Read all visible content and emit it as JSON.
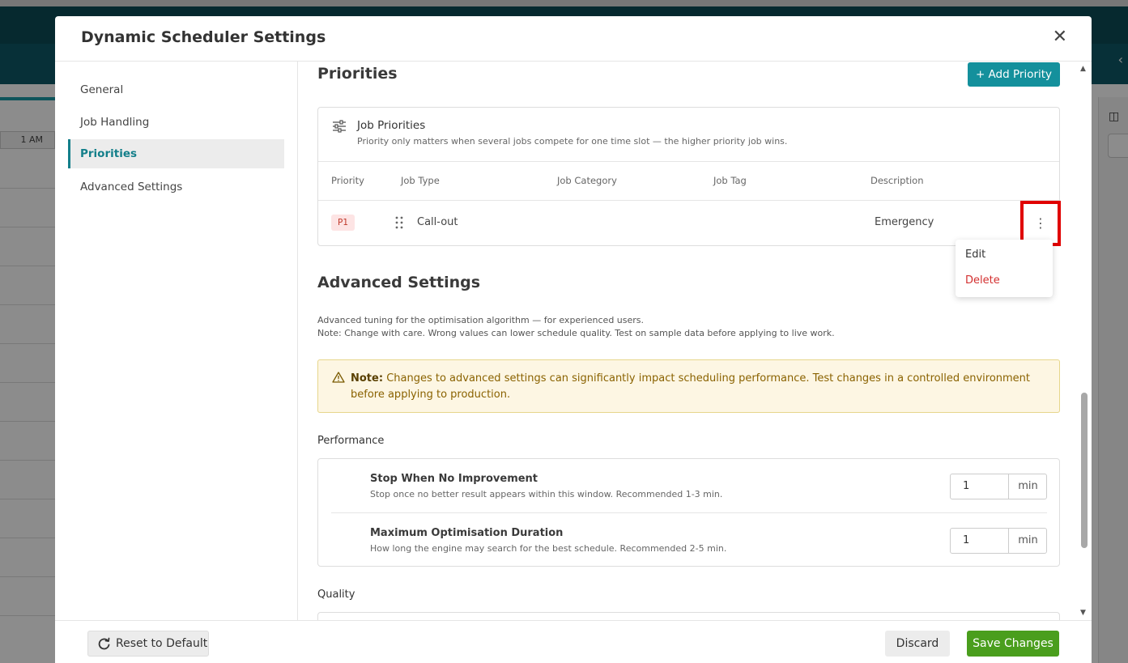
{
  "background": {
    "timeline_label": "1 AM",
    "colors": {
      "header": "#0b4b57",
      "accent": "#1b9aa6"
    }
  },
  "modal": {
    "title": "Dynamic Scheduler Settings",
    "close_icon": "close-icon"
  },
  "sidebar": {
    "items": [
      {
        "label": "General",
        "active": false
      },
      {
        "label": "Job Handling",
        "active": false
      },
      {
        "label": "Priorities",
        "active": true
      },
      {
        "label": "Advanced Settings",
        "active": false
      }
    ]
  },
  "priorities": {
    "title": "Priorities",
    "add_button": "+ Add Priority",
    "card_title": "Job Priorities",
    "card_subtitle": "Priority only matters when several jobs compete for one time slot — the higher priority job wins.",
    "columns": [
      "Priority",
      "Job Type",
      "Job Category",
      "Job Tag",
      "Description"
    ],
    "rows": [
      {
        "priority": "P1",
        "job_type": "Call-out",
        "job_category": "",
        "job_tag": "",
        "description": "Emergency"
      }
    ],
    "row_menu": {
      "edit": "Edit",
      "delete": "Delete"
    }
  },
  "advanced": {
    "title": "Advanced Settings",
    "desc_line1": "Advanced tuning for the optimisation algorithm — for experienced users.",
    "desc_line2": "Note: Change with care. Wrong values can lower schedule quality. Test on sample data before applying to live work.",
    "note_label": "Note:",
    "note_text": "Changes to advanced settings can significantly impact scheduling performance. Test changes in a controlled environment before applying to production.",
    "performance_title": "Performance",
    "performance": [
      {
        "title": "Stop When No Improvement",
        "subtitle": "Stop once no better result appears within this window. Recommended 1-3 min.",
        "value": "1",
        "unit": "min"
      },
      {
        "title": "Maximum Optimisation Duration",
        "subtitle": "How long the engine may search for the best schedule. Recommended 2-5 min.",
        "value": "1",
        "unit": "min"
      }
    ],
    "quality_title": "Quality"
  },
  "footer": {
    "reset": "Reset to Default",
    "discard": "Discard",
    "save": "Save Changes",
    "colors": {
      "save": "#4a9e1d",
      "primary": "#14909c",
      "delete": "#d32f2f"
    }
  }
}
